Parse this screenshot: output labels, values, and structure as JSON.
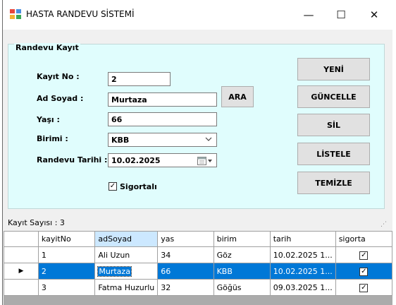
{
  "window": {
    "title": "HASTA RANDEVU SİSTEMİ",
    "minimize_glyph": "—",
    "maximize_glyph": "☐",
    "close_glyph": "✕"
  },
  "form": {
    "group_title": "Randevu Kayıt",
    "fields": {
      "kayit_no": {
        "label": "Kayıt No :",
        "value": "2"
      },
      "ad_soyad": {
        "label": "Ad Soyad :",
        "value": "Murtaza"
      },
      "yas": {
        "label": "Yaşı :",
        "value": "66"
      },
      "birim": {
        "label": "Birimi :",
        "value": "KBB"
      },
      "randevu_tarihi": {
        "label": "Randevu Tarihi :",
        "value": "10.02.2025"
      }
    },
    "search_button": "ARA",
    "sigortali": {
      "label": "Sigortalı",
      "checked": true
    },
    "buttons": {
      "yeni": "YENİ",
      "guncelle": "GÜNCELLE",
      "sil": "SİL",
      "listele": "LİSTELE",
      "temizle": "TEMİZLE"
    }
  },
  "status": {
    "text": "Kayıt Sayısı : 3"
  },
  "grid": {
    "columns": [
      "kayitNo",
      "adSoyad",
      "yas",
      "birim",
      "tarih",
      "sigorta"
    ],
    "rows": [
      {
        "kayitNo": "1",
        "adSoyad": "Ali Uzun",
        "yas": "34",
        "birim": "Göz",
        "tarih": "10.02.2025 1...",
        "sigorta": true
      },
      {
        "kayitNo": "2",
        "adSoyad": "Murtaza",
        "yas": "66",
        "birim": "KBB",
        "tarih": "10.02.2025 1...",
        "sigorta": true
      },
      {
        "kayitNo": "3",
        "adSoyad": "Fatma Huzurlu",
        "yas": "32",
        "birim": "Göğüs",
        "tarih": "09.03.2025 1...",
        "sigorta": true
      }
    ],
    "selected_row_marker": "▶",
    "check_glyph": "✓"
  },
  "colors": {
    "panel_bg": "#e0fdfd",
    "selection": "#0078d7",
    "sorted_header": "#cce8ff"
  }
}
